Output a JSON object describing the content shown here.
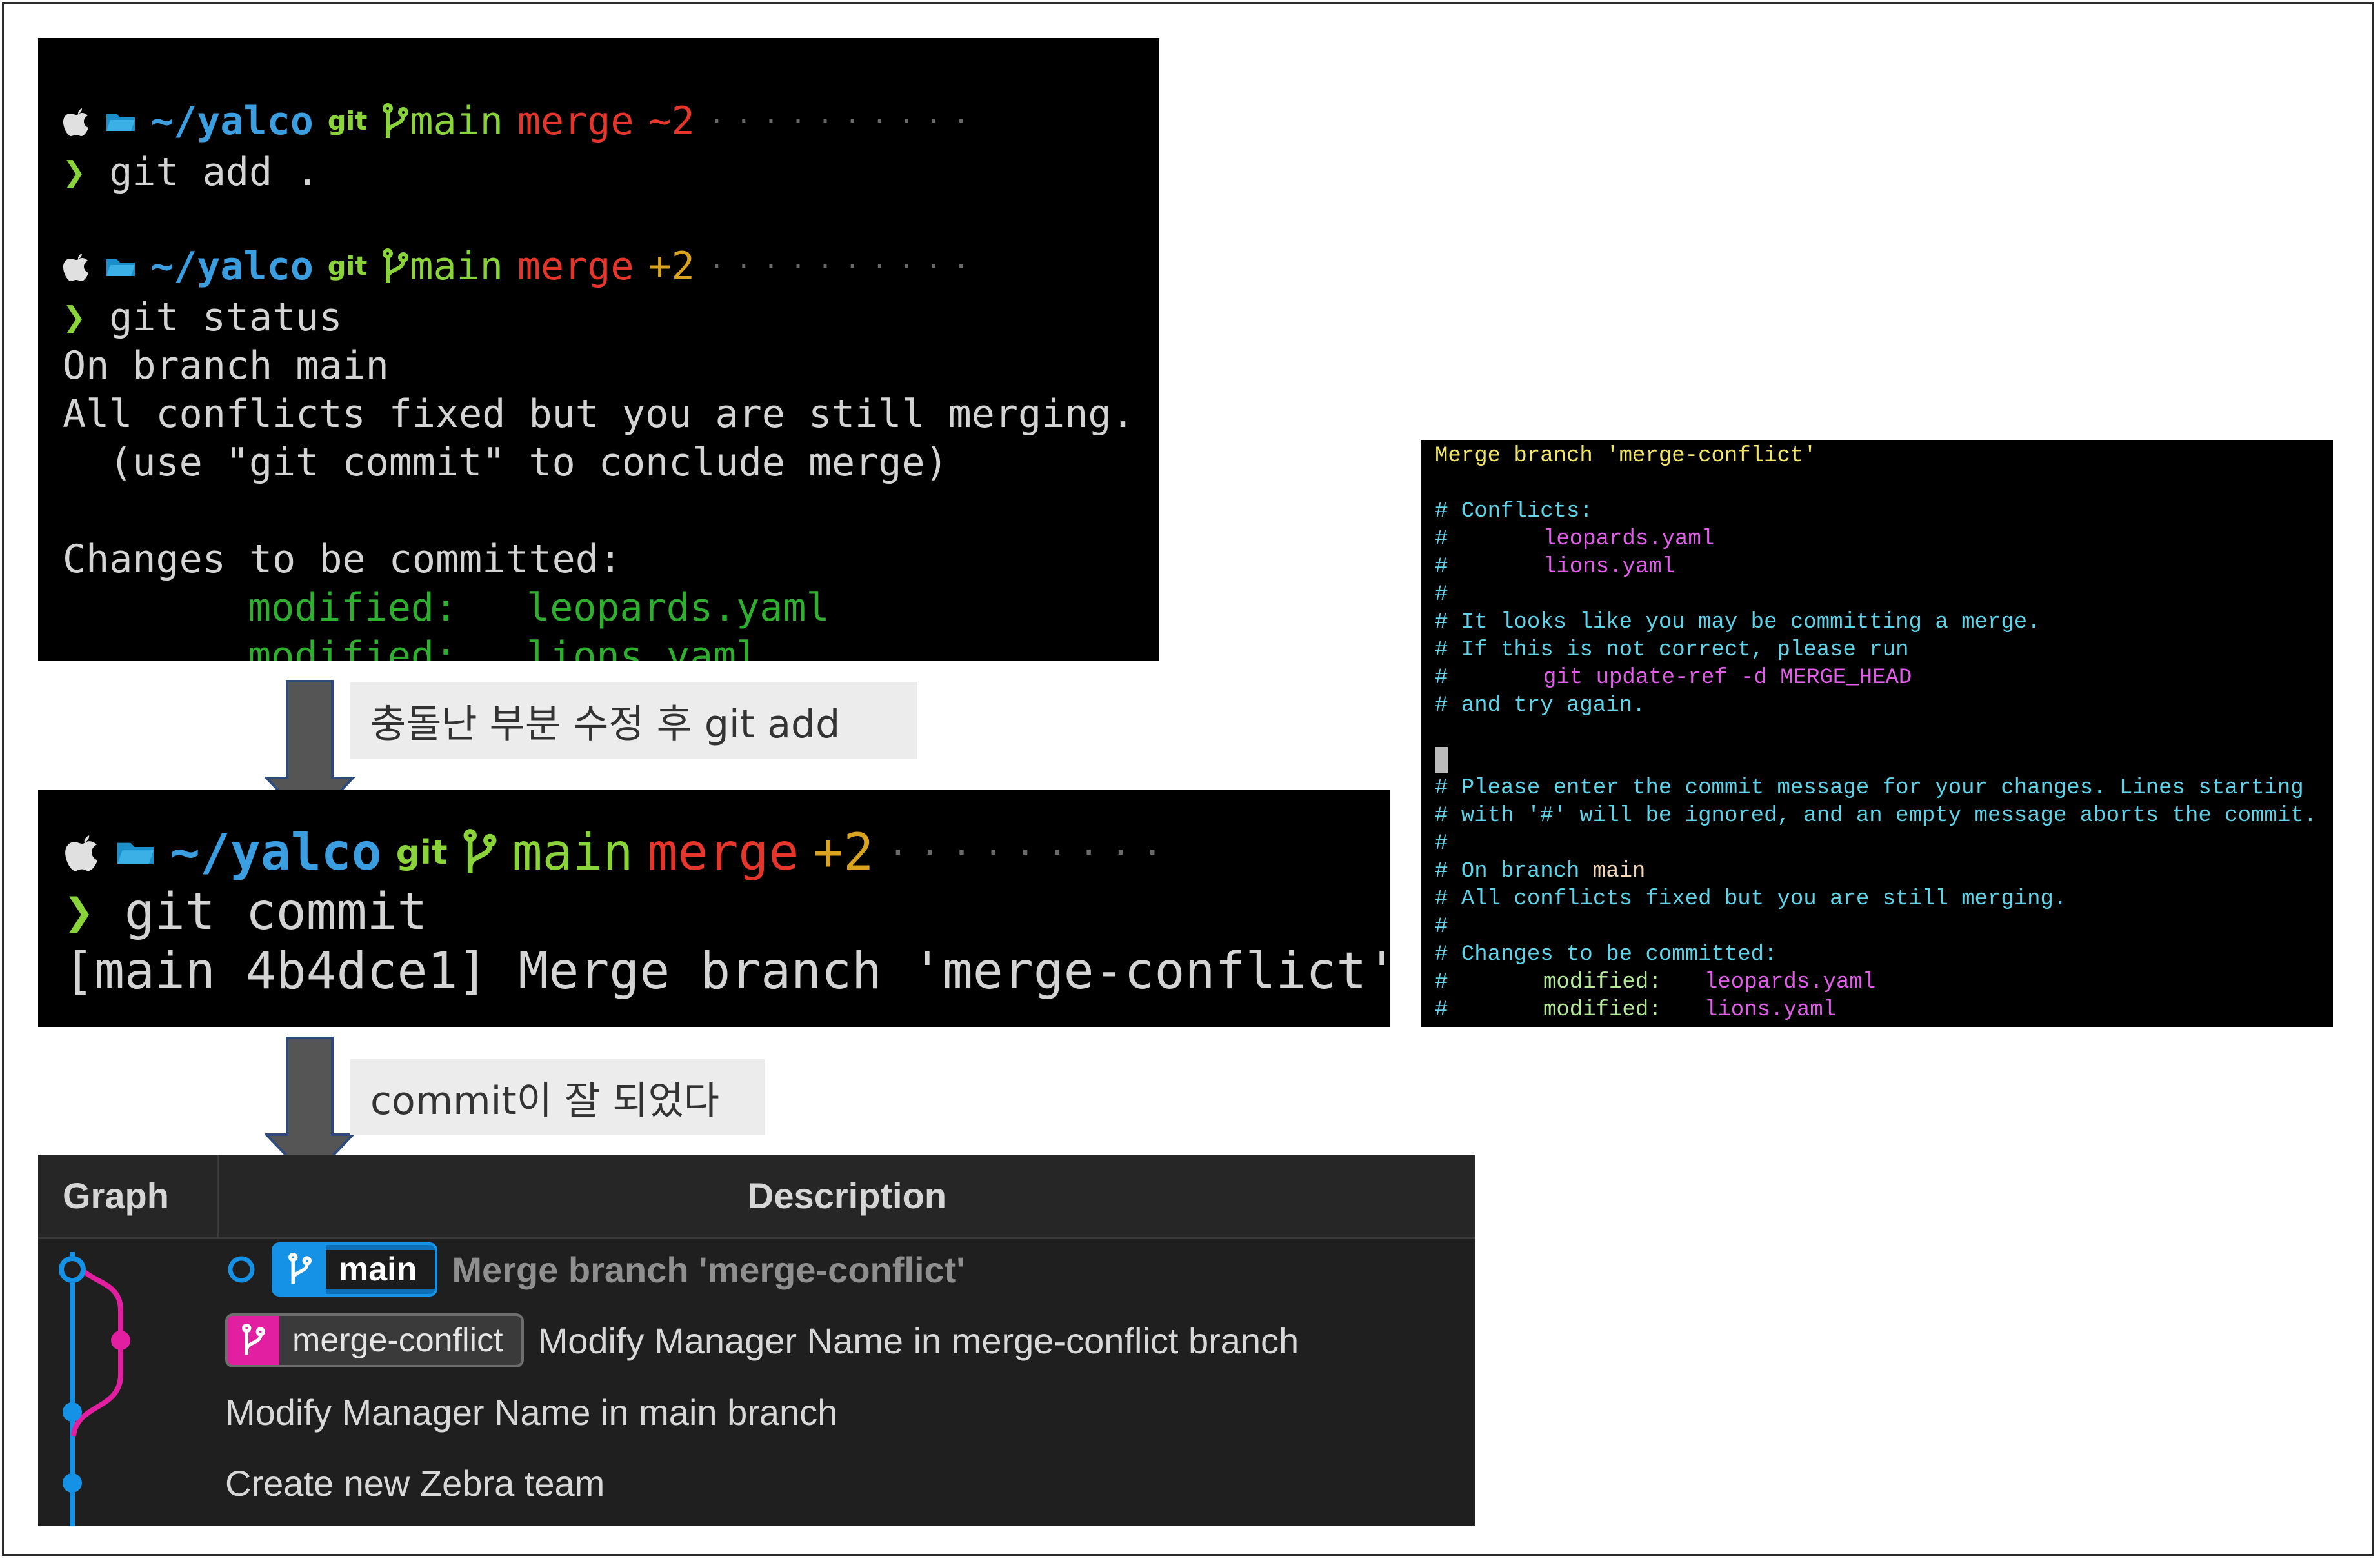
{
  "colors": {
    "path_blue": "#3b9ee0",
    "branch_green": "#8ad33a",
    "merge_red": "#e5362b",
    "count_yellow": "#d8a31e",
    "main_branch_blue": "#1591e6",
    "merge_branch_magenta": "#e21fa0"
  },
  "terminal1": {
    "prompt1": {
      "path": "~/yalco",
      "git": "git",
      "branch": "main",
      "state": "merge",
      "count": "~2",
      "dots": "··········"
    },
    "cmd1": "git add .",
    "prompt2": {
      "path": "~/yalco",
      "git": "git",
      "branch": "main",
      "state": "merge",
      "count": "+2",
      "dots": "··········"
    },
    "cmd2": "git status",
    "out1": "On branch main",
    "out2": "All conflicts fixed but you are still merging.",
    "out3": "  (use \"git commit\" to conclude merge)",
    "out4": "Changes to be committed:",
    "mod1_label": "modified:",
    "mod1_file": "leopards.yaml",
    "mod2_label": "modified:",
    "mod2_file": "lions.yaml"
  },
  "caption1": "충돌난 부분 수정 후 git add",
  "terminal2": {
    "prompt": {
      "path": "~/yalco",
      "git": "git",
      "branch": "main",
      "state": "merge",
      "count": "+2",
      "dots": "·········"
    },
    "cmd": "git commit",
    "result": "[main 4b4dce1] Merge branch 'merge-conflict'"
  },
  "caption2": "commit이 잘 되었다",
  "editor": {
    "line1": "Merge branch 'merge-conflict'",
    "line3": "# Conflicts:",
    "line4_hash": "#",
    "line4_file": "leopards.yaml",
    "line5_hash": "#",
    "line5_file": "lions.yaml",
    "line6": "#",
    "line7": "# It looks like you may be committing a merge.",
    "line8": "# If this is not correct, please run",
    "line9_hash": "#",
    "line9_cmd": "git update-ref -d MERGE_HEAD",
    "line10": "# and try again.",
    "line13": "# Please enter the commit message for your changes. Lines starting",
    "line14": "# with '#' will be ignored, and an empty message aborts the commit.",
    "line15": "#",
    "line16_prefix": "# On branch ",
    "line16_branch": "main",
    "line17": "# All conflicts fixed but you are still merging.",
    "line18": "#",
    "line19": "# Changes to be committed:",
    "line20_hash": "#",
    "line20_label": "modified:",
    "line20_file": "leopards.yaml",
    "line21_hash": "#",
    "line21_label": "modified:",
    "line21_file": "lions.yaml"
  },
  "graph": {
    "header_graph": "Graph",
    "header_description": "Description",
    "rows": [
      {
        "badge": "main",
        "message": "Merge branch 'merge-conflict'"
      },
      {
        "badge": "merge-conflict",
        "message": "Modify Manager Name in merge-conflict branch"
      },
      {
        "message": "Modify Manager Name in main branch"
      },
      {
        "message": "Create new Zebra team"
      }
    ]
  }
}
